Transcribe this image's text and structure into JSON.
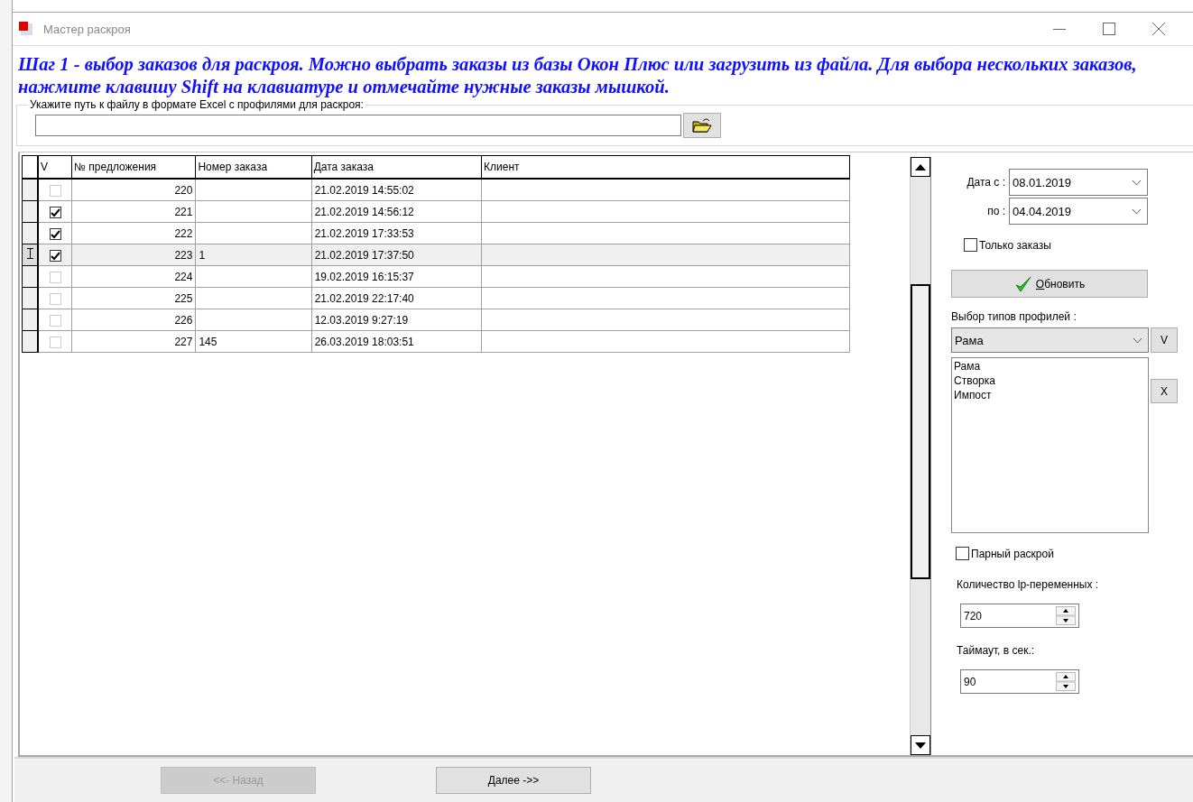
{
  "window": {
    "title": "Мастер раскроя"
  },
  "instruction": "Шаг 1 - выбор заказов для раскроя. Можно выбрать заказы из базы Окон Плюс или загрузить из файла. Для выбора нескольких заказов, нажмите клавишу Shift на клавиатуре и отмечайте нужные заказы мышкой.",
  "file_group": {
    "label": "Укажите путь к файлу в формате Excel с профилями для раскроя:"
  },
  "table": {
    "columns": [
      "V",
      "№ предложения",
      "Номер заказа",
      "Дата заказа",
      "Клиент"
    ],
    "rows": [
      {
        "checked": false,
        "selected": false,
        "number": "220",
        "order": "",
        "date": "21.02.2019 14:55:02"
      },
      {
        "checked": true,
        "selected": false,
        "number": "221",
        "order": "",
        "date": "21.02.2019 14:56:12"
      },
      {
        "checked": true,
        "selected": false,
        "number": "222",
        "order": "",
        "date": "21.02.2019 17:33:53"
      },
      {
        "checked": true,
        "selected": true,
        "number": "223",
        "order": "1",
        "date": "21.02.2019 17:37:50"
      },
      {
        "checked": false,
        "selected": false,
        "number": "224",
        "order": "",
        "date": "19.02.2019 16:15:37"
      },
      {
        "checked": false,
        "selected": false,
        "number": "225",
        "order": "",
        "date": "21.02.2019 22:17:40"
      },
      {
        "checked": false,
        "selected": false,
        "number": "226",
        "order": "",
        "date": "12.03.2019 9:27:19"
      },
      {
        "checked": false,
        "selected": false,
        "number": "227",
        "order": "145",
        "date": "26.03.2019 18:03:51"
      }
    ]
  },
  "filters": {
    "date_from": {
      "label": "Дата с :",
      "value": "08.01.2019"
    },
    "date_to": {
      "label": "по :",
      "value": "04.04.2019"
    },
    "only_orders": {
      "label": "Только заказы",
      "checked": false
    },
    "refresh_button": "Обновить",
    "profile_types": {
      "label": "Выбор типов профилей :",
      "value": "Рама",
      "add_button": "V",
      "remove_button": "X",
      "items": [
        "Рама",
        "Створка",
        "Импост"
      ]
    },
    "paired_cut": {
      "label": "Парный раскрой",
      "checked": false
    },
    "lp_count": {
      "label": "Количество lp-переменных :",
      "value": "720"
    },
    "timeout": {
      "label": "Таймаут, в сек.:",
      "value": "90"
    }
  },
  "nav_buttons": [
    {
      "label": "<<-  Назад",
      "disabled": true
    },
    {
      "label": "Далее ->>",
      "disabled": false
    }
  ]
}
